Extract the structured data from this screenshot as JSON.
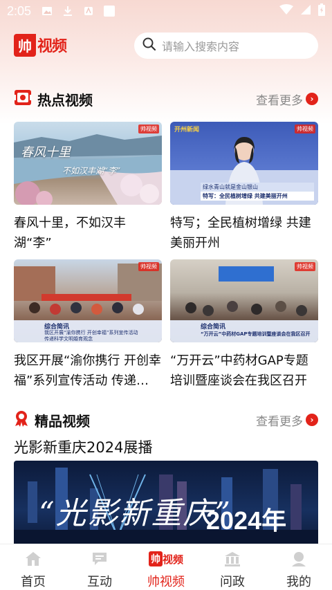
{
  "status": {
    "time": "2:05"
  },
  "header": {
    "logo_box": "帅",
    "logo_text": "视频",
    "search_placeholder": "请输入搜索内容"
  },
  "hot": {
    "title": "热点视频",
    "more": "查看更多",
    "items": [
      {
        "title": "春风十里，不如汉丰湖“李”",
        "thumb_caption_1": "春风十里",
        "thumb_caption_2": "不如汉丰湖“李”"
      },
      {
        "title": "特写；全民植树增绿 共建美丽开州",
        "thumb_caption_1": "绿水青山就是金山银山",
        "thumb_caption_2": "特写：全民植树增绿  共建美丽开州",
        "thumb_tag": "开州新闻"
      },
      {
        "title": "我区开展“渝你携行 开创幸福”系列宣传活动 传递…",
        "thumb_caption_1": "综合简讯",
        "thumb_caption_2": "我区开展“渝你携行 开创幸福”系列宣传活动",
        "thumb_caption_3": "传递科学文明婚育观念"
      },
      {
        "title": "“万开云”中药材GAP专题培训暨座谈会在我区召开",
        "thumb_caption_1": "综合简讯",
        "thumb_caption_2": "“万开云”中药材GAP专题培训暨座谈会在我区召开"
      }
    ],
    "corner_logo": "帅视频"
  },
  "featured": {
    "title": "精品视频",
    "more": "查看更多",
    "video_title": "光影新重庆2024展播",
    "banner_text": "“光影新重庆”",
    "banner_year": "2024年"
  },
  "nav": {
    "items": [
      {
        "label": "首页"
      },
      {
        "label": "互动"
      },
      {
        "label": "帅视频"
      },
      {
        "label": "问政"
      },
      {
        "label": "我的"
      }
    ],
    "logo_box": "帅",
    "logo_text": "视频"
  },
  "colors": {
    "accent": "#e2231a",
    "muted": "#888888"
  }
}
